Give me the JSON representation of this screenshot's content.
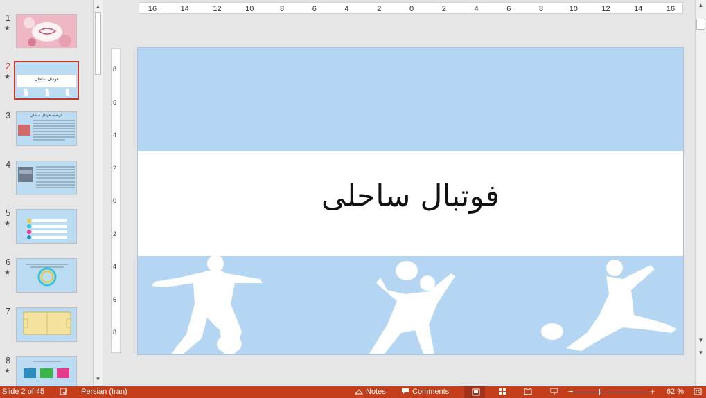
{
  "thumbnails": [
    {
      "number": "1",
      "has_animation": true
    },
    {
      "number": "2",
      "has_animation": true,
      "selected": true,
      "caption": "فوتبال ساحلی"
    },
    {
      "number": "3",
      "has_animation": false,
      "caption": "تاریخچه فوتبال ساحلی"
    },
    {
      "number": "4",
      "has_animation": false
    },
    {
      "number": "5",
      "has_animation": true
    },
    {
      "number": "6",
      "has_animation": true
    },
    {
      "number": "7",
      "has_animation": false
    },
    {
      "number": "8",
      "has_animation": true
    }
  ],
  "star_glyph": "★",
  "ruler": {
    "horizontal": [
      "16",
      "14",
      "12",
      "10",
      "8",
      "6",
      "4",
      "2",
      "0",
      "2",
      "4",
      "6",
      "8",
      "10",
      "12",
      "14",
      "16"
    ],
    "vertical": [
      "8",
      "6",
      "4",
      "2",
      "0",
      "2",
      "4",
      "6",
      "8"
    ]
  },
  "slide": {
    "title": "فوتبال ساحلی",
    "background": "#b5d6f2",
    "band_color": "#ffffff"
  },
  "status": {
    "slide_info": "Slide 2 of 45",
    "language": "Persian (Iran)",
    "notes": "Notes",
    "comments": "Comments",
    "zoom": "62 %",
    "accent": "#c43e1c"
  },
  "icons": {
    "scroll_up": "▲",
    "scroll_down": "▼",
    "zoom_out": "−",
    "zoom_in": "+"
  }
}
